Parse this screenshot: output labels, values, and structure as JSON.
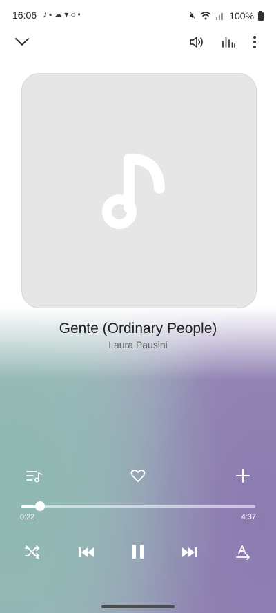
{
  "status_bar": {
    "time": "16:06",
    "battery": "100%",
    "left_icons": [
      "music-note-icon",
      "chat-icon",
      "cloud-icon",
      "teams-icon",
      "circle-icon",
      "dot-icon"
    ],
    "right_icons": [
      "mute-icon",
      "wifi-icon",
      "signal-icon",
      "battery-icon"
    ]
  },
  "player": {
    "song_title": "Gente (Ordinary People)",
    "artist": "Laura Pausini",
    "elapsed": "0:22",
    "total": "4:37",
    "progress_fraction": 0.08
  },
  "colors": {
    "teal": "#8fb8b2",
    "purple": "#8b7bb0",
    "art_bg": "#e6e6e6"
  }
}
